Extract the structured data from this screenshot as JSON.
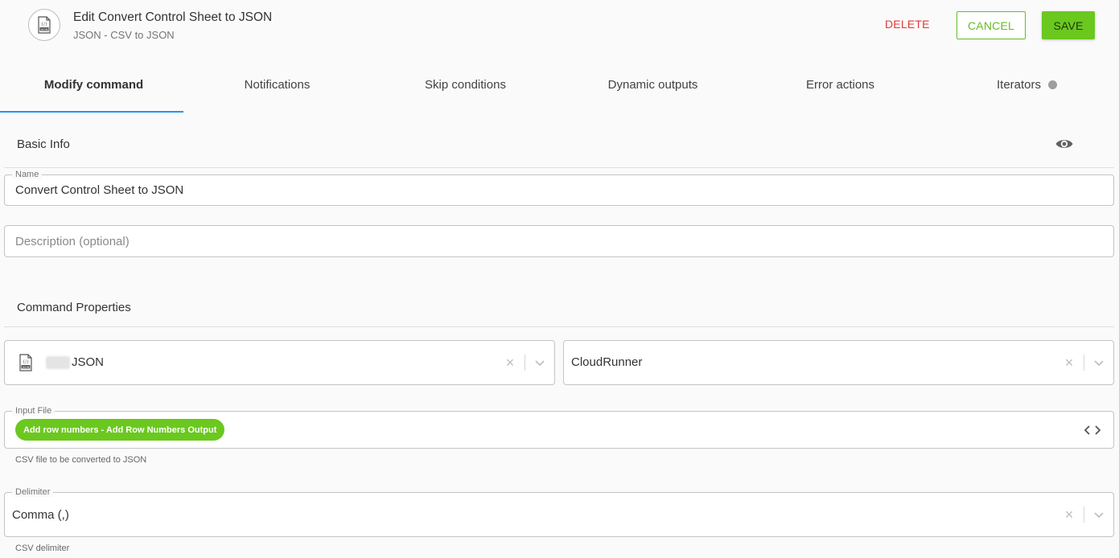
{
  "header": {
    "title": "Edit Convert Control Sheet to JSON",
    "subtitle": "JSON - CSV to JSON",
    "icon": "json-file-icon",
    "delete_label": "DELETE",
    "cancel_label": "CANCEL",
    "save_label": "SAVE"
  },
  "tabs": [
    {
      "label": "Modify command",
      "active": true
    },
    {
      "label": "Notifications"
    },
    {
      "label": "Skip conditions"
    },
    {
      "label": "Dynamic outputs"
    },
    {
      "label": "Error actions"
    },
    {
      "label": "Iterators"
    }
  ],
  "basic_info": {
    "title": "Basic Info",
    "name_label": "Name",
    "name_value": "Convert Control Sheet to JSON",
    "description_placeholder": "Description (optional)"
  },
  "command_properties": {
    "title": "Command Properties",
    "connector_value": "JSON",
    "runner_value": "CloudRunner",
    "input_file_label": "Input File",
    "input_file_chip": "Add row numbers - Add Row Numbers Output",
    "input_file_helper": "CSV file to be converted to JSON",
    "delimiter_label": "Delimiter",
    "delimiter_value": "Comma (,)",
    "delimiter_helper": "CSV delimiter"
  },
  "colors": {
    "accent_green": "#6bc81f",
    "delete_red": "#e53935",
    "tab_indicator": "#2196f3"
  }
}
